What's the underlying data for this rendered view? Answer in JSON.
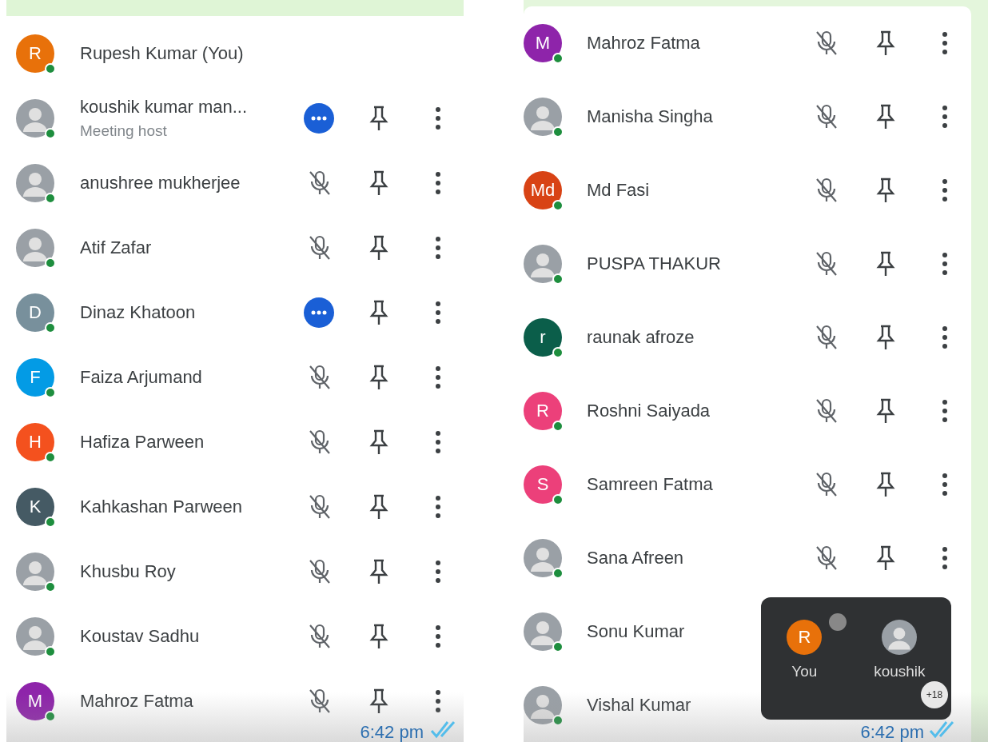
{
  "panels": [
    {
      "kind": "plain",
      "participants": [
        {
          "name": "Rupesh Kumar (You)",
          "avatar": {
            "kind": "letter",
            "letter": "R",
            "color": "#e8710a"
          },
          "kind": "plain"
        },
        {
          "name": "koushik kumar man...",
          "subtitle": "Meeting host",
          "avatar": {
            "kind": "photo"
          },
          "kind": "speaking"
        },
        {
          "name": "anushree mukherjee",
          "avatar": {
            "kind": "photo"
          },
          "kind": "muted"
        },
        {
          "name": "Atif Zafar",
          "avatar": {
            "kind": "photo"
          },
          "kind": "muted"
        },
        {
          "name": "Dinaz Khatoon",
          "avatar": {
            "kind": "letter",
            "letter": "D",
            "color": "#78909c"
          },
          "kind": "speaking"
        },
        {
          "name": "Faiza Arjumand",
          "avatar": {
            "kind": "letter",
            "letter": "F",
            "color": "#039be5"
          },
          "kind": "muted"
        },
        {
          "name": "Hafiza Parween",
          "avatar": {
            "kind": "letter",
            "letter": "H",
            "color": "#f4511e"
          },
          "kind": "muted"
        },
        {
          "name": "Kahkashan Parween",
          "avatar": {
            "kind": "letter",
            "letter": "K",
            "color": "#455a64"
          },
          "kind": "muted"
        },
        {
          "name": "Khusbu Roy",
          "avatar": {
            "kind": "photo"
          },
          "kind": "muted"
        },
        {
          "name": "Koustav Sadhu",
          "avatar": {
            "kind": "photo"
          },
          "kind": "muted"
        },
        {
          "name": "Mahroz Fatma",
          "avatar": {
            "kind": "letter",
            "letter": "M",
            "color": "#8e24aa"
          },
          "kind": "muted"
        }
      ],
      "timestamp": "6:42 pm"
    },
    {
      "kind": "framed",
      "participants": [
        {
          "name": "Mahroz Fatma",
          "avatar": {
            "kind": "letter",
            "letter": "M",
            "color": "#8e24aa"
          },
          "kind": "muted"
        },
        {
          "name": "Manisha Singha",
          "avatar": {
            "kind": "photo"
          },
          "kind": "muted"
        },
        {
          "name": "Md Fasi",
          "avatar": {
            "kind": "letter",
            "letter": "Md",
            "color": "#d84315"
          },
          "kind": "muted"
        },
        {
          "name": "PUSPA THAKUR",
          "avatar": {
            "kind": "photo"
          },
          "kind": "muted"
        },
        {
          "name": "raunak afroze",
          "avatar": {
            "kind": "letter",
            "letter": "r",
            "color": "#0b5e4a"
          },
          "kind": "muted"
        },
        {
          "name": "Roshni Saiyada",
          "avatar": {
            "kind": "letter",
            "letter": "R",
            "color": "#ec407a"
          },
          "kind": "muted"
        },
        {
          "name": "Samreen Fatma",
          "avatar": {
            "kind": "letter",
            "letter": "S",
            "color": "#ec407a"
          },
          "kind": "muted"
        },
        {
          "name": "Sana Afreen",
          "avatar": {
            "kind": "photo"
          },
          "kind": "muted"
        },
        {
          "name": "Sonu Kumar",
          "avatar": {
            "kind": "photo"
          },
          "kind": "plain"
        },
        {
          "name": "Vishal Kumar",
          "avatar": {
            "kind": "photo"
          },
          "kind": "plain"
        }
      ],
      "timestamp": "6:42 pm",
      "selfview": {
        "tiles": [
          {
            "label": "You",
            "avatar": {
              "kind": "letter",
              "letter": "R",
              "color": "#e8710a"
            }
          },
          {
            "label": "koushik",
            "avatar": {
              "kind": "photo"
            }
          }
        ],
        "more": "+18"
      }
    }
  ]
}
